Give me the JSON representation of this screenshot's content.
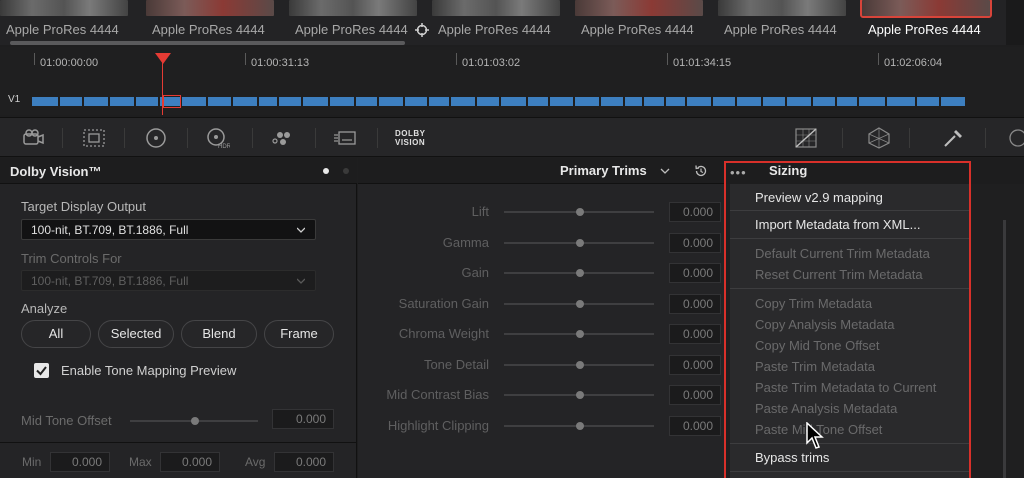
{
  "clips": {
    "items": [
      {
        "label": "Apple ProRes 4444"
      },
      {
        "label": "Apple ProRes 4444"
      },
      {
        "label": "Apple ProRes 4444"
      },
      {
        "label": "Apple ProRes 4444"
      },
      {
        "label": "Apple ProRes 4444"
      },
      {
        "label": "Apple ProRes 4444"
      },
      {
        "label": "Apple ProRes 4444"
      }
    ],
    "selected_index": 6
  },
  "timeline": {
    "timecodes": [
      "01:00:00:00",
      "01:00:31:13",
      "01:01:03:02",
      "01:01:34:15",
      "01:02:06:04"
    ],
    "track_label": "V1"
  },
  "toolbar": {
    "dolby_logo_line1": "DOLBY",
    "dolby_logo_line2": "VISION"
  },
  "left_panel": {
    "title": "Dolby Vision™",
    "target_display_label": "Target Display Output",
    "target_display_value": "100-nit, BT.709, BT.1886, Full",
    "trim_controls_label": "Trim Controls For",
    "trim_controls_value": "100-nit, BT.709, BT.1886, Full",
    "analyze_label": "Analyze",
    "analyze_buttons": {
      "all": "All",
      "selected": "Selected",
      "blend": "Blend",
      "frame": "Frame"
    },
    "tone_mapping_label": "Enable Tone Mapping Preview",
    "tone_mapping_checked": true,
    "mid_tone_label": "Mid Tone Offset",
    "mid_tone_value": "0.000",
    "min_label": "Min",
    "min_value": "0.000",
    "max_label": "Max",
    "max_value": "0.000",
    "avg_label": "Avg",
    "avg_value": "0.000"
  },
  "primary_trims": {
    "title": "Primary Trims",
    "rows": [
      {
        "label": "Lift",
        "value": "0.000"
      },
      {
        "label": "Gamma",
        "value": "0.000"
      },
      {
        "label": "Gain",
        "value": "0.000"
      },
      {
        "label": "Saturation Gain",
        "value": "0.000"
      },
      {
        "label": "Chroma Weight",
        "value": "0.000"
      },
      {
        "label": "Tone Detail",
        "value": "0.000"
      },
      {
        "label": "Mid Contrast Bias",
        "value": "0.000"
      },
      {
        "label": "Highlight Clipping",
        "value": "0.000"
      }
    ]
  },
  "sizing": {
    "title": "Sizing",
    "menu": [
      {
        "label": "Preview v2.9 mapping",
        "enabled": true
      },
      {
        "label": "Import Metadata from XML...",
        "enabled": true
      },
      {
        "label": "Default Current Trim Metadata",
        "enabled": false
      },
      {
        "label": "Reset Current Trim Metadata",
        "enabled": false
      },
      {
        "label": "Copy Trim Metadata",
        "enabled": false
      },
      {
        "label": "Copy Analysis Metadata",
        "enabled": false
      },
      {
        "label": "Copy Mid Tone Offset",
        "enabled": false
      },
      {
        "label": "Paste Trim Metadata",
        "enabled": false
      },
      {
        "label": "Paste Trim Metadata to Current",
        "enabled": false
      },
      {
        "label": "Paste Analysis Metadata",
        "enabled": false
      },
      {
        "label": "Paste Mid Tone Offset",
        "enabled": false
      },
      {
        "label": "Bypass trims",
        "enabled": true
      }
    ]
  },
  "colors": {
    "accent_red": "#d8302a",
    "track_blue": "#3d7fc0",
    "panel_bg": "#242426"
  }
}
